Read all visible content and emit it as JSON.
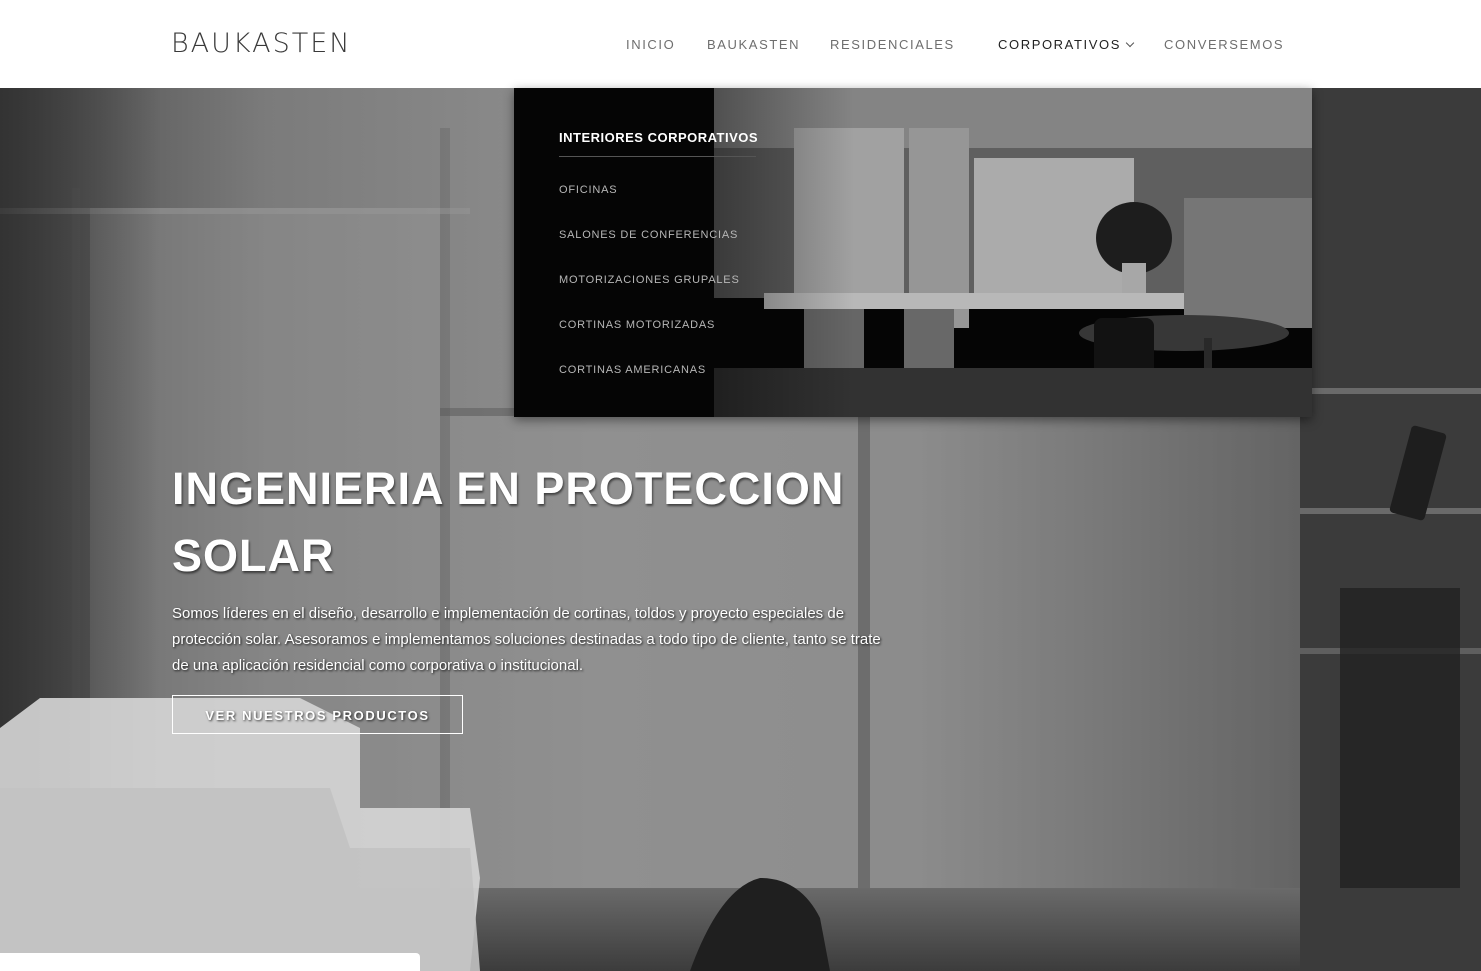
{
  "brand": {
    "logo": "BAUKASTEN"
  },
  "nav": {
    "items": [
      {
        "label": "INICIO"
      },
      {
        "label": "BAUKASTEN"
      },
      {
        "label": "RESIDENCIALES"
      },
      {
        "label": "CORPORATIVOS",
        "active": true,
        "has_dropdown": true
      },
      {
        "label": "CONVERSEMOS"
      }
    ]
  },
  "dropdown": {
    "title": "INTERIORES CORPORATIVOS",
    "items": [
      {
        "label": "OFICINAS"
      },
      {
        "label": "SALONES DE CONFERENCIAS"
      },
      {
        "label": "MOTORIZACIONES GRUPALES"
      },
      {
        "label": "CORTINAS MOTORIZADAS"
      },
      {
        "label": "CORTINAS AMERICANAS"
      }
    ]
  },
  "hero": {
    "title": "INGENIERIA EN PROTECCION SOLAR",
    "text": "Somos líderes en el diseño, desarrollo e implementación de cortinas, toldos y proyecto especiales de protección solar. Asesoramos e implementamos soluciones destinadas a todo tipo de cliente, tanto se trate de una aplicación residencial como corporativa o institucional.",
    "cta_label": "VER NUESTROS PRODUCTOS"
  },
  "colors": {
    "header_bg": "#ffffff",
    "nav_text": "#6e6e6e",
    "nav_active": "#222222",
    "dropdown_bg": "#050505",
    "dropdown_title": "#ffffff",
    "dropdown_item": "#b7b7b7"
  },
  "icons": {
    "dropdown_indicator": "chevron-down-icon"
  }
}
